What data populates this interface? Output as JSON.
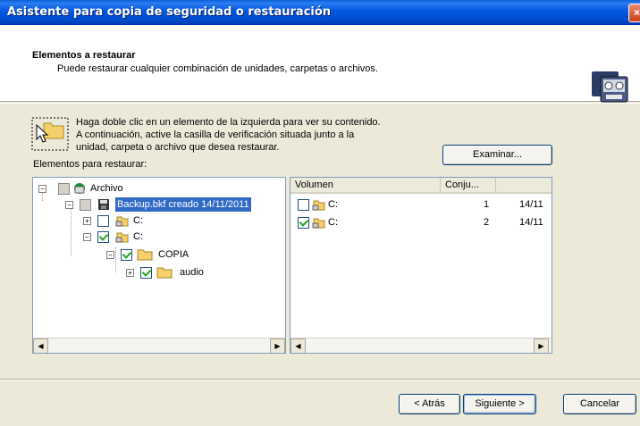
{
  "window": {
    "title": "Asistente para copia de seguridad o restauración",
    "close_glyph": "×"
  },
  "header": {
    "title": "Elementos a restaurar",
    "subtitle": "Puede restaurar cualquier combinación de unidades, carpetas o archivos.",
    "icon": "backup-tape-icon"
  },
  "instructions": {
    "lines": [
      "Haga doble clic en un elemento de la izquierda para ver su contenido.",
      "A continuación, active la casilla de verificación situada junto a la",
      "unidad, carpeta o archivo que desea restaurar."
    ],
    "icon": "folder-pointer-icon"
  },
  "list_label": "Elementos para restaurar:",
  "browse_button": "Examinar...",
  "tree": [
    {
      "label": "Archivo",
      "icon": "archive-icon",
      "checked": "grey",
      "expanded": true
    },
    {
      "label": "Backup.bkf creado 14/11/2011",
      "icon": "floppy-icon",
      "checked": "grey",
      "expanded": true,
      "selected": true
    },
    {
      "label": "C:",
      "icon": "drive-icon",
      "checked": "off",
      "expanded": false
    },
    {
      "label": "C:",
      "icon": "drive-icon",
      "checked": "on",
      "expanded": true
    },
    {
      "label": "COPIA",
      "icon": "folder-icon",
      "checked": "on",
      "expanded": true
    },
    {
      "label": "audio",
      "icon": "folder-icon",
      "checked": "on",
      "expanded": false
    }
  ],
  "list": {
    "columns": [
      "Volumen",
      "Conju...",
      ""
    ],
    "rows": [
      {
        "volumen": "C:",
        "conjunto": "1",
        "fecha": "14/11",
        "checked": false
      },
      {
        "volumen": "C:",
        "conjunto": "2",
        "fecha": "14/11",
        "checked": true
      }
    ]
  },
  "buttons": {
    "back": "< Atrás",
    "next": "Siguiente >",
    "cancel": "Cancelar"
  },
  "colors": {
    "title_blue": "#0058e0",
    "selection": "#316ac5",
    "check_green": "#21a121",
    "folder": "#f5d06a"
  }
}
